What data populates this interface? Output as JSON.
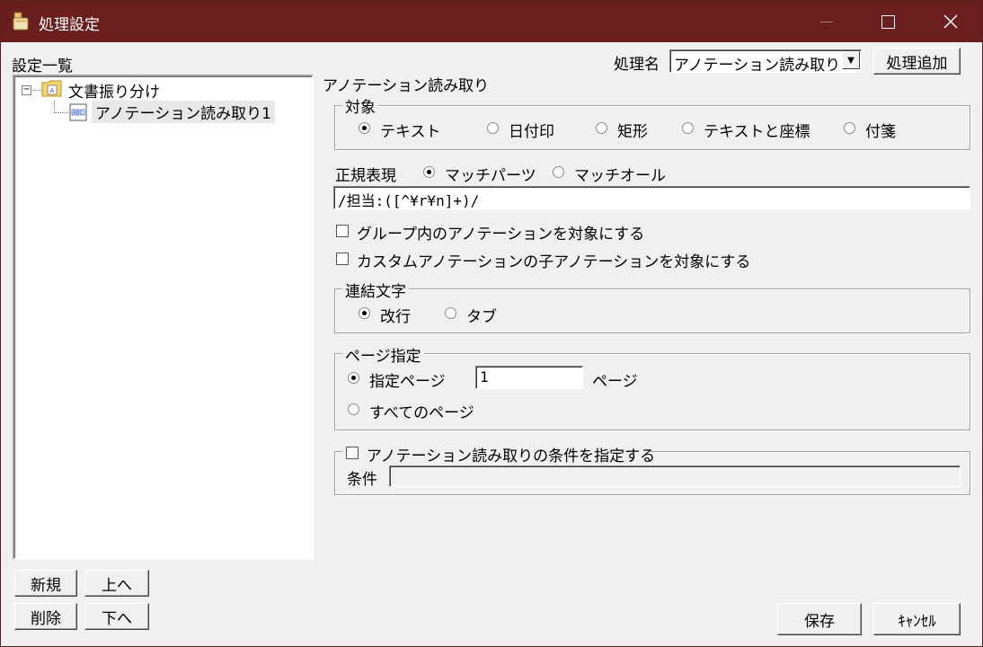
{
  "window": {
    "title": "処理設定"
  },
  "left": {
    "heading": "設定一覧",
    "tree": {
      "root_toggle": "⊟",
      "root_label": "文書振り分け",
      "child_label": "アノテーション読み取り1"
    },
    "buttons": {
      "new": "新規",
      "up": "上へ",
      "delete": "削除",
      "down": "下へ"
    }
  },
  "header": {
    "process_name_label": "処理名",
    "process_name_value": "アノテーション読み取り",
    "add_button": "処理追加"
  },
  "panel": {
    "section_title": "アノテーション読み取り",
    "target": {
      "title": "対象",
      "options": [
        "テキスト",
        "日付印",
        "矩形",
        "テキストと座標",
        "付箋"
      ],
      "selected": 0
    },
    "regex": {
      "label": "正規表現",
      "options": [
        "マッチパーツ",
        "マッチオール"
      ],
      "selected": 0,
      "value": "/担当:([^¥r¥n]+)/"
    },
    "checks": [
      {
        "label": "グループ内のアノテーションを対象にする",
        "checked": false
      },
      {
        "label": "カスタムアノテーションの子アノテーションを対象にする",
        "checked": false
      }
    ],
    "join": {
      "title": "連結文字",
      "options": [
        "改行",
        "タブ"
      ],
      "selected": 0
    },
    "page": {
      "title": "ページ指定",
      "option_specified": "指定ページ",
      "page_value": "1",
      "page_unit": "ページ",
      "option_all": "すべてのページ",
      "selected": 0
    },
    "condition": {
      "title": "アノテーション読み取りの条件を指定する",
      "checked": false,
      "label": "条件",
      "value": ""
    }
  },
  "footer": {
    "save": "保存",
    "cancel": "ｷｬﾝｾﾙ"
  }
}
